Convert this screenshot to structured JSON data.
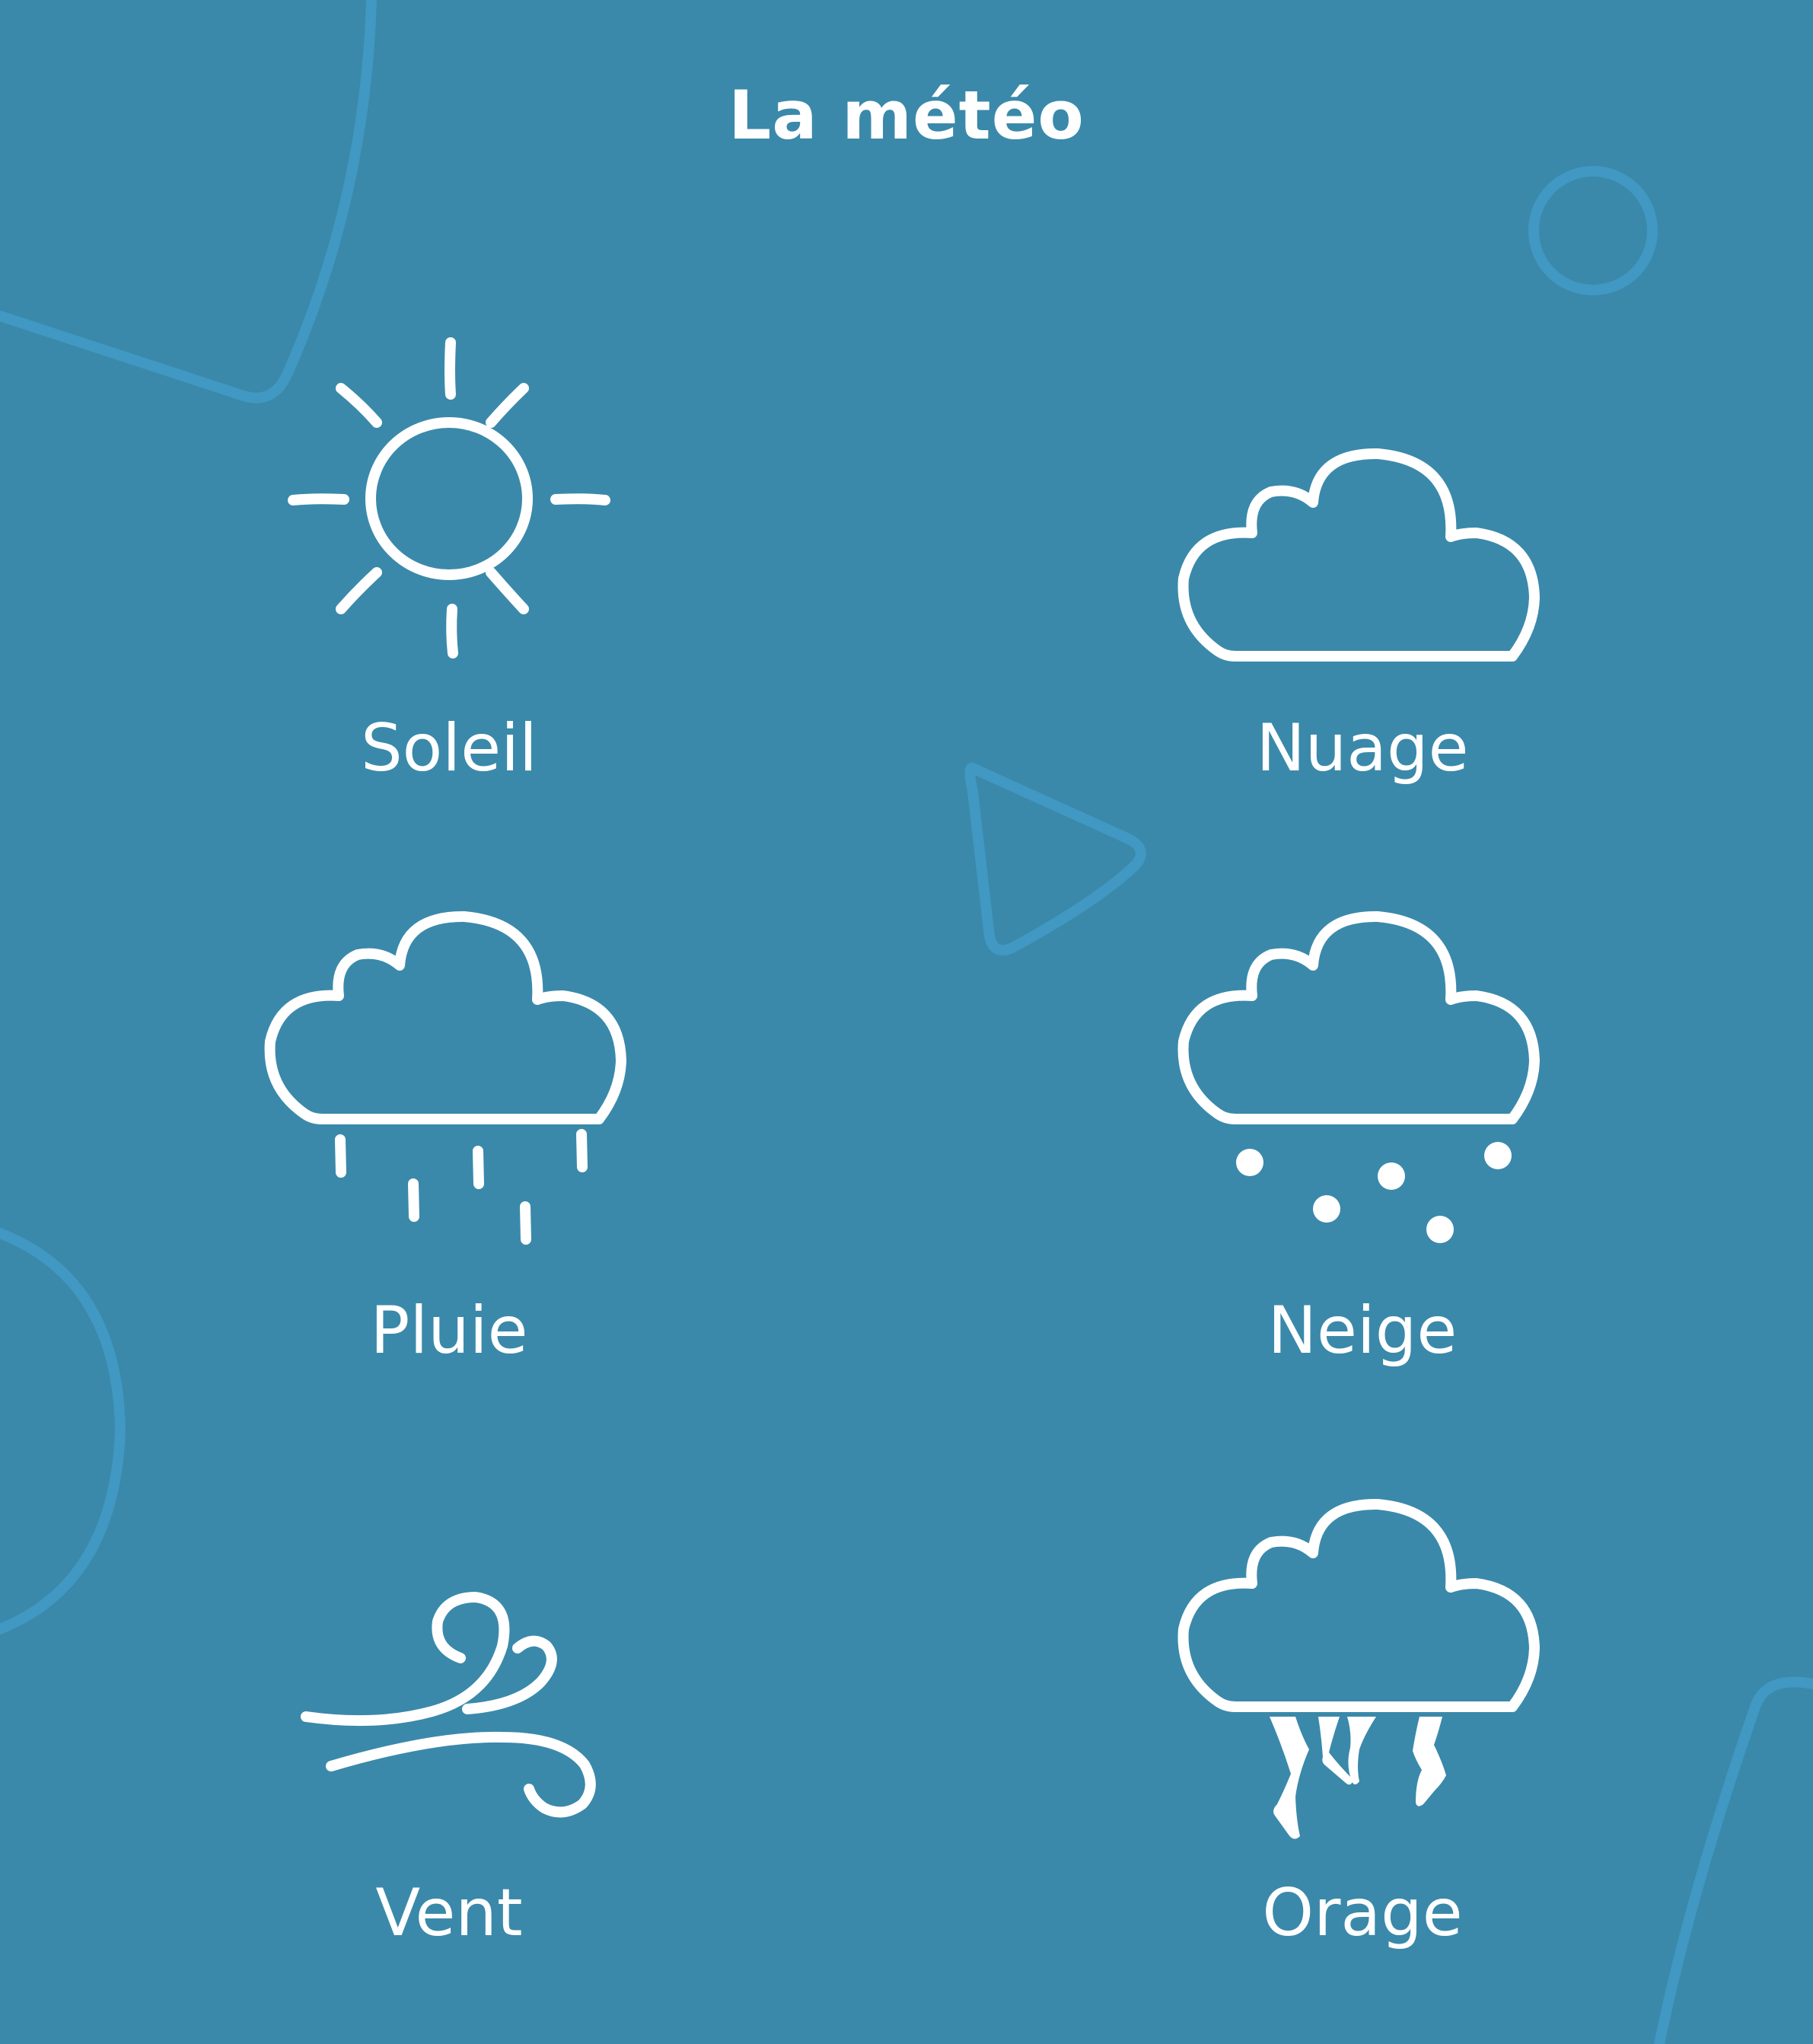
{
  "title": "La météo",
  "colors": {
    "background": "#3a89aa",
    "decoration": "#4198c2",
    "foreground": "#ffffff"
  },
  "items": [
    {
      "icon": "sun-icon",
      "label": "Soleil"
    },
    {
      "icon": "cloud-icon",
      "label": "Nuage"
    },
    {
      "icon": "rain-icon",
      "label": "Pluie"
    },
    {
      "icon": "snow-icon",
      "label": "Neige"
    },
    {
      "icon": "wind-icon",
      "label": "Vent"
    },
    {
      "icon": "storm-icon",
      "label": "Orage"
    }
  ]
}
